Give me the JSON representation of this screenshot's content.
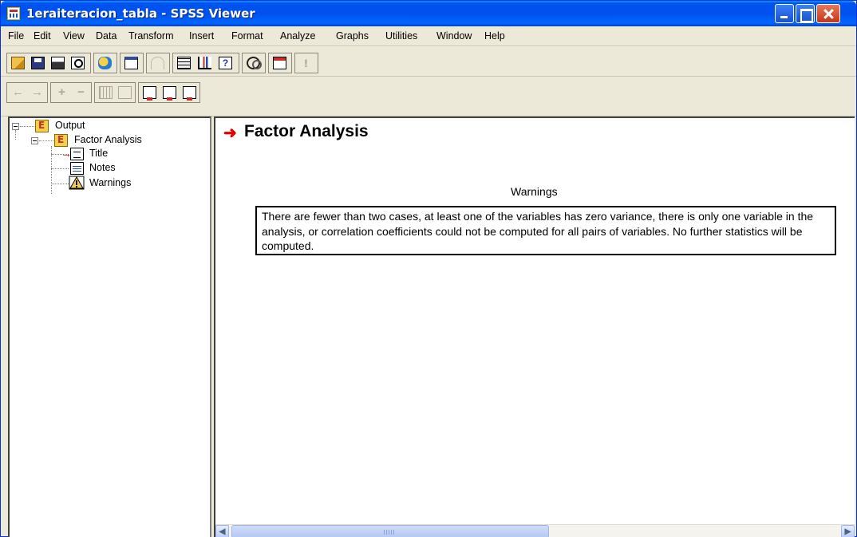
{
  "window": {
    "title": "1eraiteracion_tabla - SPSS Viewer"
  },
  "menu": {
    "items": [
      "File",
      "Edit",
      "View",
      "Data",
      "Transform",
      "Insert",
      "Format",
      "Analyze",
      "Graphs",
      "Utilities",
      "Window",
      "Help"
    ]
  },
  "outline": {
    "root": "Output",
    "procedure": "Factor Analysis",
    "children": [
      "Title",
      "Notes",
      "Warnings"
    ]
  },
  "viewer": {
    "heading": "Factor Analysis",
    "warnings_title": "Warnings",
    "warning_text": "There are fewer than two cases, at least one of the variables has zero variance, there is only one variable in the analysis, or correlation coefficients could not be computed for all pairs of variables. No further statistics will be computed."
  },
  "icons": {
    "title_icon": "spss-viewer-icon",
    "minimize": "minimize-icon",
    "maximize": "maximize-icon",
    "close": "close-icon"
  },
  "colors": {
    "titlebar": "#0053ee",
    "chrome": "#ece9d8",
    "arrow": "#e00000"
  }
}
